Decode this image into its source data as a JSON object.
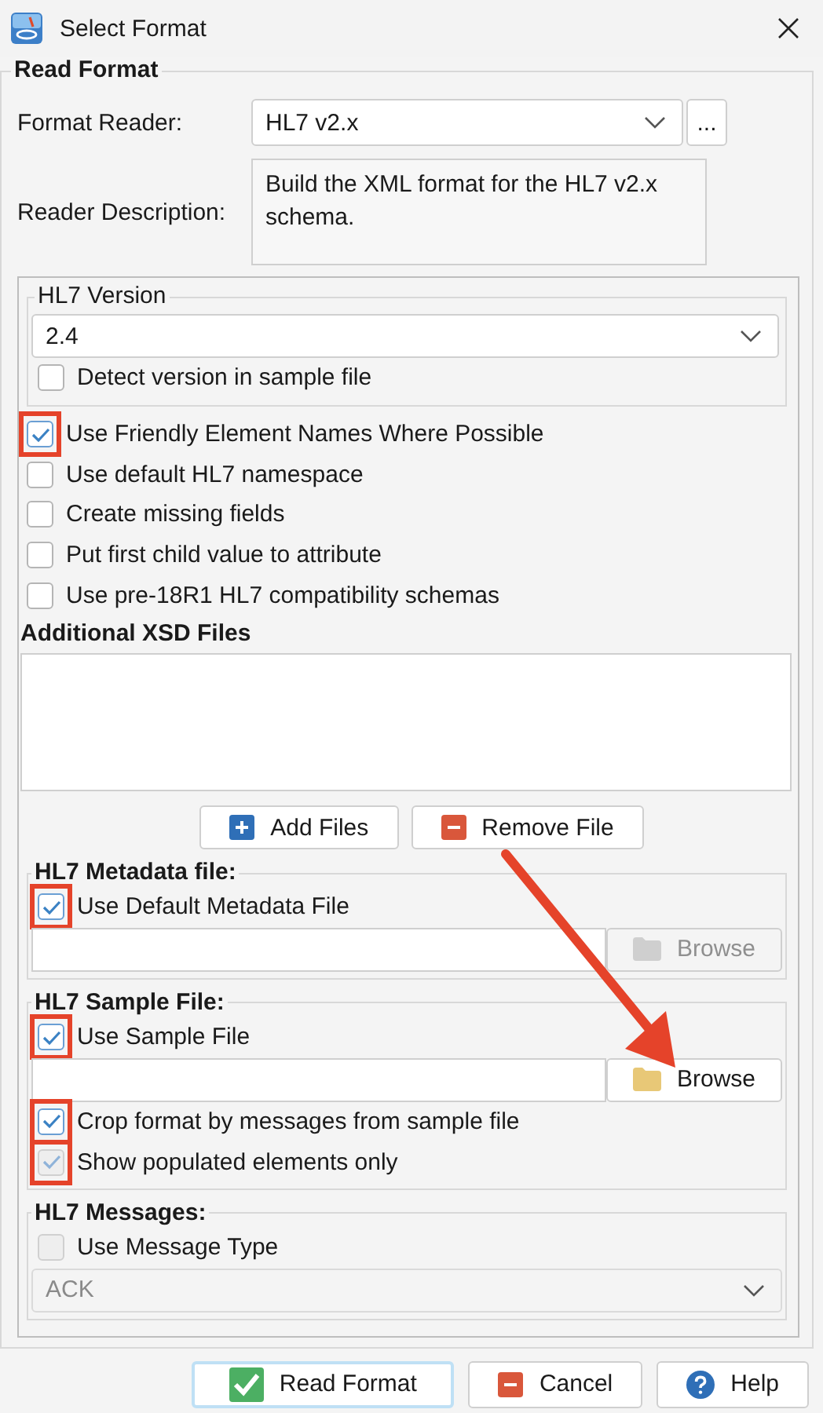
{
  "window": {
    "title": "Select Format"
  },
  "read_format": {
    "legend": "Read Format",
    "format_reader": {
      "label": "Format Reader:",
      "value": "HL7 v2.x",
      "more_button": "..."
    },
    "reader_description": {
      "label": "Reader Description:",
      "value": "Build the XML format for the HL7 v2.x schema."
    }
  },
  "hl7_version": {
    "legend": "HL7 Version",
    "value": "2.4",
    "detect": {
      "label": "Detect version in sample file",
      "checked": false,
      "disabled": false,
      "highlighted": false
    }
  },
  "options": [
    {
      "label": "Use Friendly Element Names Where Possible",
      "checked": true,
      "disabled": false,
      "highlighted": true
    },
    {
      "label": "Use default HL7 namespace",
      "checked": false,
      "disabled": false,
      "highlighted": false
    },
    {
      "label": "Create missing fields",
      "checked": false,
      "disabled": false,
      "highlighted": false
    },
    {
      "label": "Put first child value to attribute",
      "checked": false,
      "disabled": false,
      "highlighted": false
    },
    {
      "label": "Use pre-18R1 HL7 compatibility schemas",
      "checked": false,
      "disabled": false,
      "highlighted": false
    }
  ],
  "additional_xsd": {
    "heading": "Additional XSD Files",
    "buttons": [
      {
        "label": "Add Files",
        "kind": "add"
      },
      {
        "label": "Remove File",
        "kind": "remove"
      }
    ]
  },
  "metadata": {
    "legend": "HL7 Metadata file:",
    "checkbox": {
      "label": "Use Default Metadata File",
      "checked": true,
      "disabled": false,
      "highlighted": true
    },
    "browse": {
      "label": "Browse",
      "disabled": true
    }
  },
  "sample": {
    "legend": "HL7 Sample File:",
    "checkbox": {
      "label": "Use Sample File",
      "checked": true,
      "disabled": false,
      "highlighted": true
    },
    "browse": {
      "label": "Browse",
      "disabled": false
    },
    "options": [
      {
        "label": "Crop format by messages from sample file",
        "checked": true,
        "disabled": false,
        "highlighted": true
      },
      {
        "label": "Show populated elements only",
        "checked": true,
        "disabled": true,
        "highlighted": true
      }
    ]
  },
  "messages": {
    "legend": "HL7 Messages:",
    "checkbox": {
      "label": "Use Message Type",
      "checked": false,
      "disabled": true,
      "highlighted": false
    },
    "type_select": {
      "value": "ACK",
      "disabled": true
    }
  },
  "footer_buttons": [
    {
      "label": "Read Format",
      "kind": "ok",
      "default": true
    },
    {
      "label": "Cancel",
      "kind": "cancel",
      "default": false
    },
    {
      "label": "Help",
      "kind": "help",
      "default": false
    }
  ]
}
